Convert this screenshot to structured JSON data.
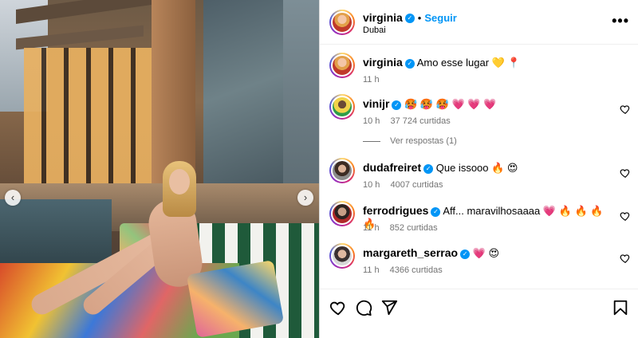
{
  "post": {
    "author": "virginia",
    "follow_label": "Seguir",
    "dot": "•",
    "location": "Dubai",
    "more_label": "•••"
  },
  "caption": {
    "author": "virginia",
    "text": "Amo esse lugar 💛 📍",
    "time": "11 h"
  },
  "comments": [
    {
      "user": "vinijr",
      "text": "🥵 🥵 🥵 💗 💗 💗",
      "time": "10 h",
      "likes": "37 724 curtidas"
    },
    {
      "user": "dudafreiret",
      "text": "Que issooo 🔥 😍",
      "time": "10 h",
      "likes": "4007 curtidas"
    },
    {
      "user": "ferrodrigues",
      "text": "Aff... maravilhosaaaa 💗 🔥 🔥 🔥 🔥",
      "time": "11 h",
      "likes": "852 curtidas"
    },
    {
      "user": "margareth_serrao",
      "text": "💗 😍",
      "time": "11 h",
      "likes": "4366 curtidas"
    }
  ],
  "replies_label": "Ver respostas (1)",
  "icons": {
    "verified": "verified-badge-icon",
    "like": "heart-icon",
    "comment": "comment-icon",
    "share": "share-icon",
    "save": "bookmark-icon",
    "carousel_prev": "chevron-left-icon",
    "carousel_next": "chevron-right-icon"
  },
  "colors": {
    "link": "#0095f6",
    "muted": "#737373",
    "verified": "#0095f6"
  }
}
